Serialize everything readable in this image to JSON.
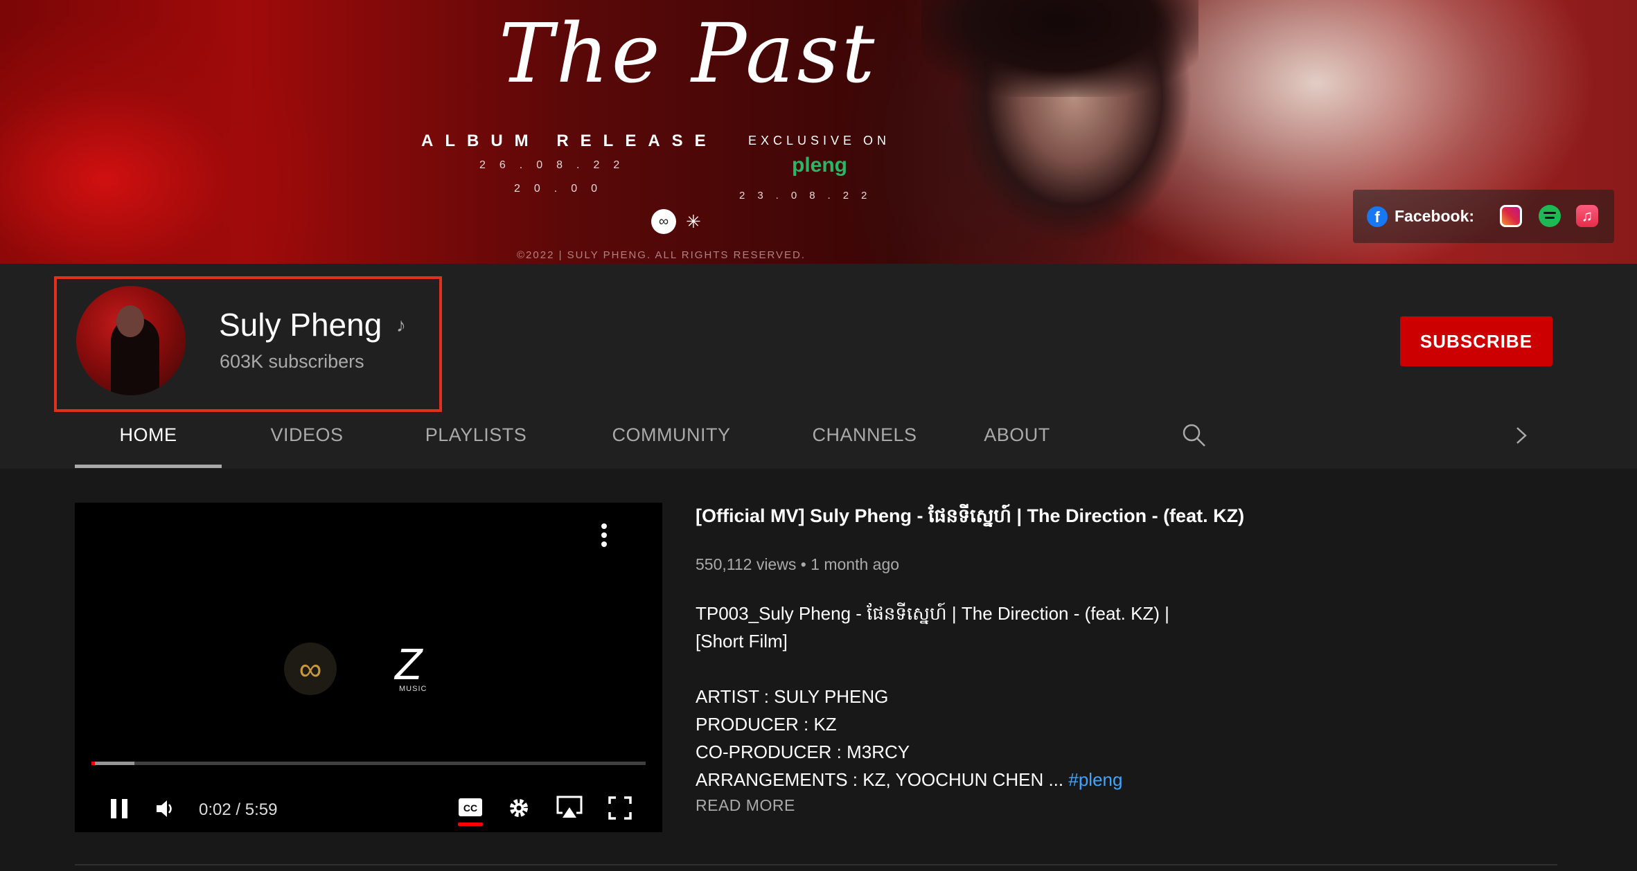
{
  "banner": {
    "title": "The Past",
    "album_release": "ALBUM RELEASE",
    "album_date": "26.08.22",
    "album_time": "20.00",
    "exclusive_on": "EXCLUSIVE ON",
    "exclusive_brand": "pleng",
    "exclusive_date": "23.08.22",
    "copyright": "©2022 | SULY PHENG. ALL RIGHTS RESERVED.",
    "links": {
      "facebook_label": "Facebook:",
      "icons": [
        "facebook-icon",
        "instagram-icon",
        "spotify-icon",
        "apple-music-icon"
      ]
    }
  },
  "channel": {
    "name": "Suly Pheng",
    "badge_icon": "music-note-icon",
    "subscribers": "603K subscribers",
    "subscribe_label": "SUBSCRIBE"
  },
  "tabs": [
    {
      "label": "HOME",
      "active": true
    },
    {
      "label": "VIDEOS",
      "active": false
    },
    {
      "label": "PLAYLISTS",
      "active": false
    },
    {
      "label": "COMMUNITY",
      "active": false
    },
    {
      "label": "CHANNELS",
      "active": false
    },
    {
      "label": "ABOUT",
      "active": false
    }
  ],
  "player": {
    "time": "0:02 / 5:59",
    "played_fraction": 0.006,
    "buffered_fraction": 0.078,
    "logo_sub": "MUSIC"
  },
  "video": {
    "title": "[Official MV] Suly Pheng - ផែនទីស្នេហ៍ | The Direction - (feat. KZ)",
    "meta": "550,112 views • 1 month ago",
    "description_lines": [
      "TP003_Suly Pheng - ផែនទីស្នេហ៍ | The Direction - (feat. KZ) |",
      "[Short Film]",
      "",
      "ARTIST : SULY PHENG",
      "PRODUCER : KZ",
      "CO-PRODUCER : M3RCY",
      "ARRANGEMENTS : KZ, YOOCHUN CHEN ..."
    ],
    "hashtag": "#pleng",
    "read_more": "READ MORE"
  },
  "colors": {
    "accent_red": "#cc0000",
    "highlight_box": "#e0301e",
    "link_blue": "#3ea6ff",
    "background": "#181818",
    "header_bg": "#202020"
  }
}
